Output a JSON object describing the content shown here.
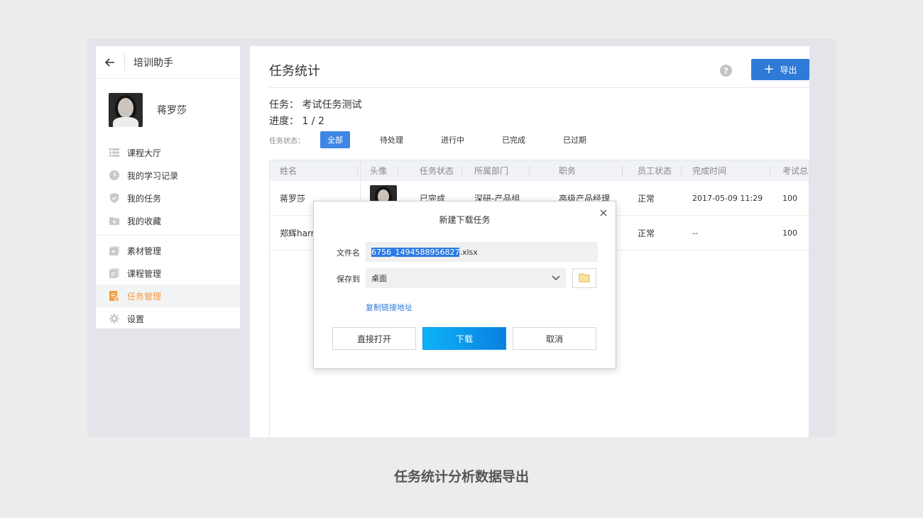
{
  "sidebar": {
    "title": "培训助手",
    "user_name": "蒋罗莎",
    "menu_group1": [
      {
        "label": "课程大厅",
        "icon": "list-icon"
      },
      {
        "label": "我的学习记录",
        "icon": "clock-icon"
      },
      {
        "label": "我的任务",
        "icon": "shield-check-icon"
      },
      {
        "label": "我的收藏",
        "icon": "folder-star-icon"
      }
    ],
    "menu_group2": [
      {
        "label": "素材管理",
        "icon": "media-icon"
      },
      {
        "label": "课程管理",
        "icon": "book-icon"
      },
      {
        "label": "任务管理",
        "icon": "task-doc-icon",
        "active": true
      },
      {
        "label": "设置",
        "icon": "gear-icon"
      }
    ]
  },
  "main": {
    "title": "任务统计",
    "help": "?",
    "export_label": "导出",
    "task_label": "任务： 考试任务测试",
    "progress_label": "进度： 1 / 2",
    "status_label": "任务状态：",
    "filters": [
      "全部",
      "待处理",
      "进行中",
      "已完成",
      "已过期"
    ],
    "active_filter": "全部"
  },
  "table": {
    "headers": [
      "姓名",
      "头像",
      "任务状态",
      "所属部门",
      "职务",
      "员工状态",
      "完成时间",
      "考试总分"
    ],
    "rows": [
      {
        "name": "蒋罗莎",
        "status": "已完成",
        "dept": "深研-产品组",
        "title": "高级产品经理",
        "emp_status": "正常",
        "time": "2017-05-09 11:29",
        "score": "100"
      },
      {
        "name": "郑辉harry",
        "status": "",
        "dept": "",
        "title": "",
        "emp_status": "正常",
        "time": "--",
        "score": "100"
      }
    ]
  },
  "dialog": {
    "title": "新建下载任务",
    "filename_label": "文件名",
    "filename_selected": "6756_1494588956827",
    "filename_ext": ".xlsx",
    "saveto_label": "保存到",
    "saveto_value": "桌面",
    "copy_link": "复制链接地址",
    "btn_open": "直接打开",
    "btn_download": "下载",
    "btn_cancel": "取消"
  },
  "caption": "任务统计分析数据导出",
  "colors": {
    "accent": "#2f7ad6",
    "active_menu": "#f39a3d",
    "filter_active": "#3d86e4"
  }
}
